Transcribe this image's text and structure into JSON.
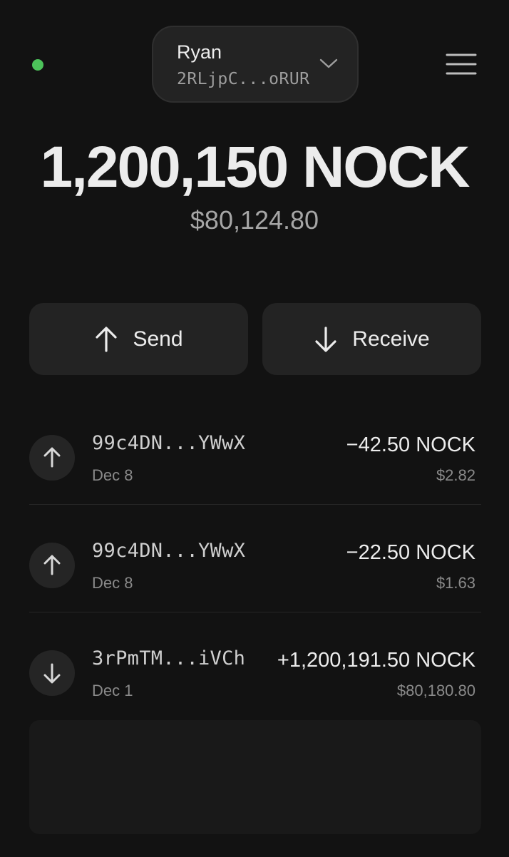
{
  "colors": {
    "status_online": "#4cc35a",
    "background": "#121212",
    "surface": "#232323"
  },
  "header": {
    "status_icon": "status-dot-icon",
    "account": {
      "name": "Ryan",
      "address": "2RLjpC...oRUR",
      "dropdown_icon": "chevron-down-icon"
    },
    "menu_icon": "hamburger-menu-icon"
  },
  "balance": {
    "amount": "1,200,150 NOCK",
    "usd": "$80,124.80"
  },
  "actions": {
    "send": {
      "label": "Send",
      "icon": "arrow-up-icon"
    },
    "receive": {
      "label": "Receive",
      "icon": "arrow-down-icon"
    }
  },
  "transactions": [
    {
      "direction": "out",
      "icon": "arrow-up-icon",
      "address": "99c4DN...YWwX",
      "date": "Dec 8",
      "amount": "−42.50 NOCK",
      "usd": "$2.82"
    },
    {
      "direction": "out",
      "icon": "arrow-up-icon",
      "address": "99c4DN...YWwX",
      "date": "Dec 8",
      "amount": "−22.50 NOCK",
      "usd": "$1.63"
    },
    {
      "direction": "in",
      "icon": "arrow-down-icon",
      "address": "3rPmTM...iVCh",
      "date": "Dec 1",
      "amount": "+1,200,191.50 NOCK",
      "usd": "$80,180.80"
    }
  ]
}
